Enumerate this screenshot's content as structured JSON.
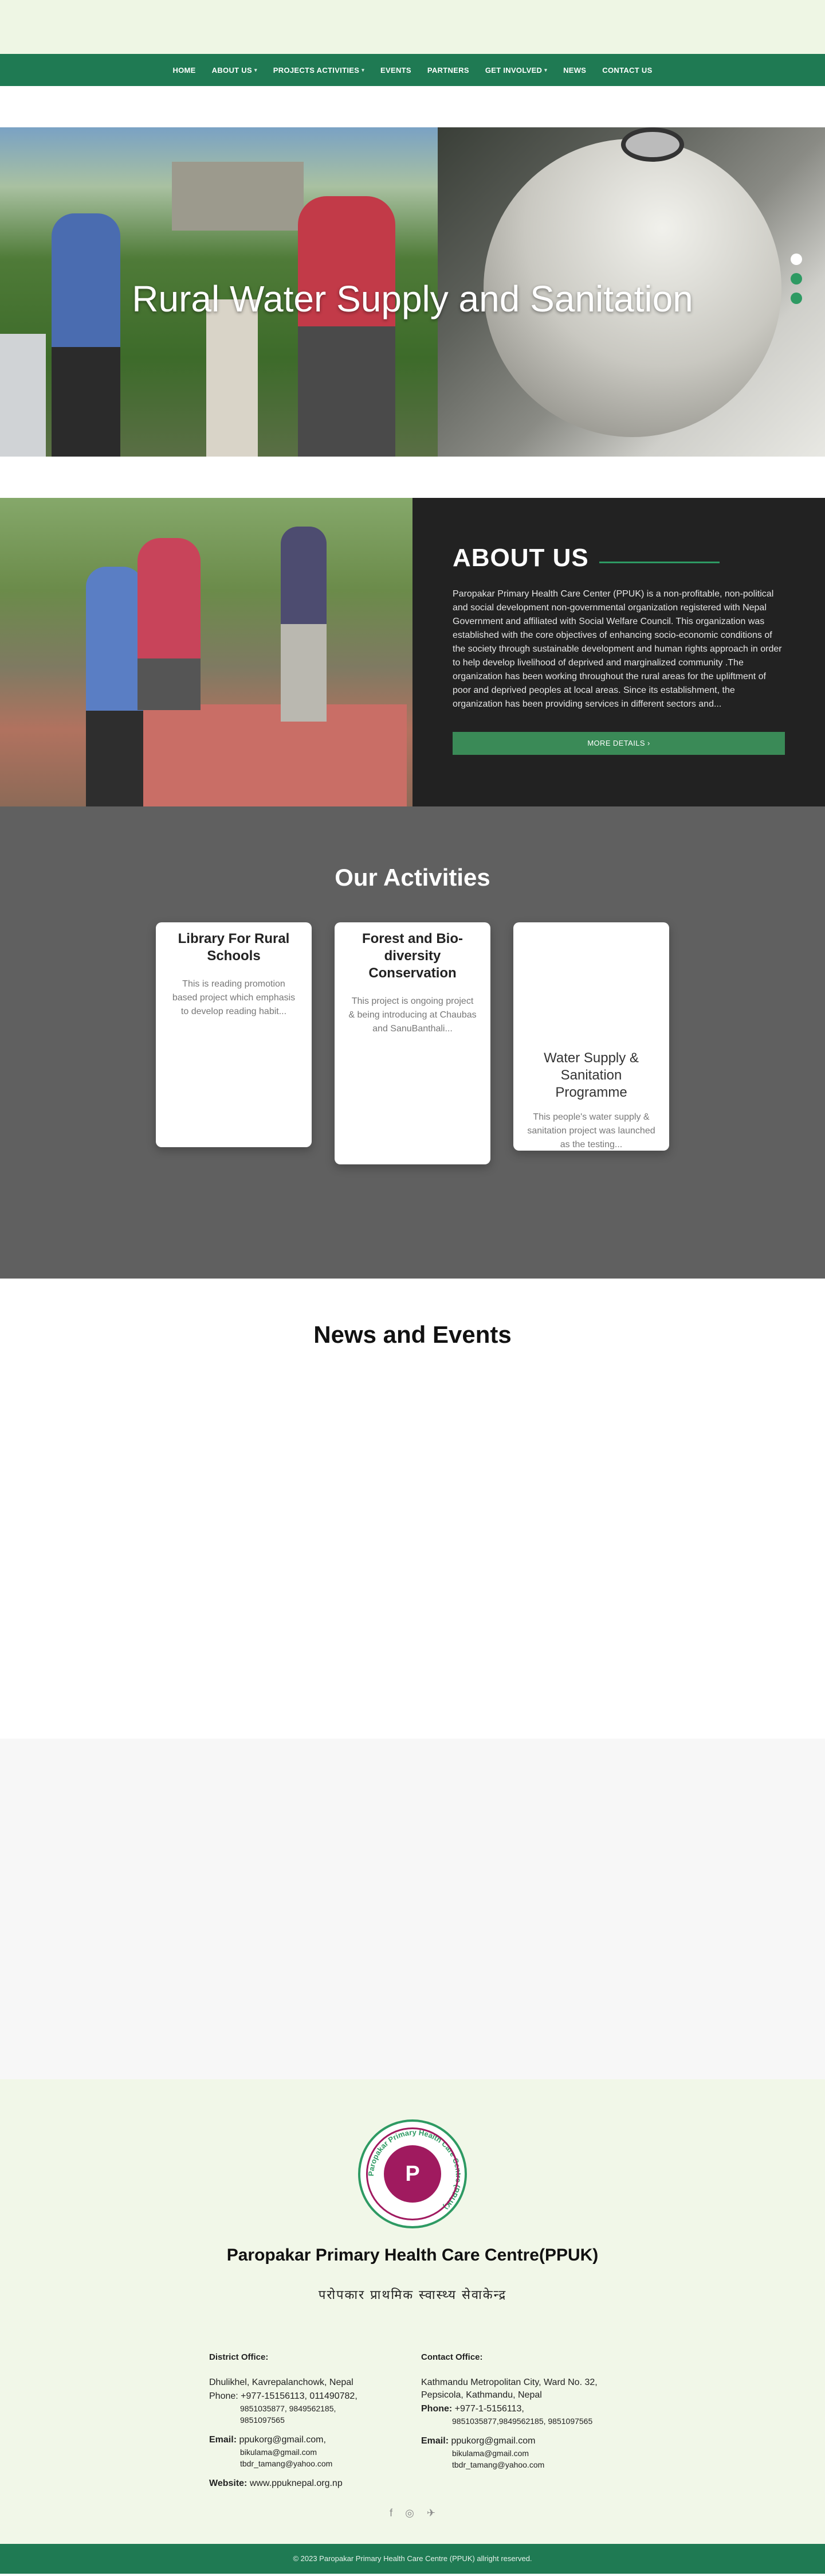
{
  "nav": {
    "items": [
      {
        "label": "HOME",
        "dropdown": false
      },
      {
        "label": "ABOUT US",
        "dropdown": true
      },
      {
        "label": "PROJECTS ACTIVITIES",
        "dropdown": true
      },
      {
        "label": "EVENTS",
        "dropdown": false
      },
      {
        "label": "PARTNERS",
        "dropdown": false
      },
      {
        "label": "GET INVOLVED",
        "dropdown": true
      },
      {
        "label": "NEWS",
        "dropdown": false
      },
      {
        "label": "CONTACT US",
        "dropdown": false
      }
    ]
  },
  "hero": {
    "title": "Rural Water Supply and Sanitation",
    "slide_count": 3,
    "active_slide": 1
  },
  "about": {
    "heading": "ABOUT US",
    "body": "Paropakar Primary Health Care Center (PPUK) is a non-profitable, non-political and social development non-governmental organization registered with Nepal Government and affiliated with Social Welfare Council. This organization was established with the core objectives of enhancing socio-economic conditions of the society through sustainable development and human rights approach in order to help develop livelihood of deprived and marginalized community .The organization has been working throughout the rural areas for the upliftment of poor and deprived peoples at local areas.  Since its establishment, the organization has been providing services in different sectors and...",
    "button_label": "MORE DETAILS ›"
  },
  "activities": {
    "heading": "Our Activities",
    "cards": [
      {
        "title": "Library For Rural Schools",
        "text": "This is reading promotion based project which emphasis to develop reading habit..."
      },
      {
        "title": "Forest and Bio-diversity Conservation",
        "text": "This project is ongoing project & being introducing at Chaubas and SanuBanthali..."
      },
      {
        "title": "Water Supply & Sanitation Programme",
        "text": "This people's water supply & sanitation project was launched as the testing..."
      }
    ]
  },
  "news": {
    "heading": "News and Events"
  },
  "footer": {
    "logo_text": "Paropakar Primary Health Care Centre (PPUK)",
    "logo_monogram": "P",
    "org_name": "Paropakar Primary Health Care Centre(PPUK)",
    "org_name_np": "परोपकार प्राथमिक स्वास्थ्य सेवाकेन्द्र",
    "district": {
      "heading": "District Office:",
      "address": "Dhulikhel, Kavrepalanchowk, Nepal",
      "phone_label": "Phone:",
      "phone": "+977-15156113, 011490782,",
      "phone_more": "9851035877, 9849562185, 9851097565",
      "email_label": "Email:",
      "email1": "ppukorg@gmail.com,",
      "email2": "bikulama@gmail.com",
      "email3": "tbdr_tamang@yahoo.com",
      "website_label": "Website:",
      "website": "www.ppuknepal.org.np"
    },
    "contact": {
      "heading": "Contact Office:",
      "address": "Kathmandu Metropolitan City, Ward No. 32, Pepsicola, Kathmandu, Nepal",
      "phone_label": "Phone:",
      "phone": "+977-1-5156113,",
      "phone_more": "9851035877,9849562185, 9851097565",
      "email_label": "Email:",
      "email1": "ppukorg@gmail.com",
      "email2": "bikulama@gmail.com",
      "email3": "tbdr_tamang@yahoo.com"
    },
    "socials": [
      {
        "icon": "facebook-icon",
        "glyph": "f"
      },
      {
        "icon": "instagram-icon",
        "glyph": "◎"
      },
      {
        "icon": "twitter-icon",
        "glyph": "✈"
      }
    ],
    "copyright": "© 2023 Paropakar Primary Health Care Centre (PPUK) allright reserved."
  },
  "colors": {
    "brand_green": "#1f7a53",
    "accent_green": "#2e9a63",
    "logo_magenta": "#a01a5f"
  }
}
